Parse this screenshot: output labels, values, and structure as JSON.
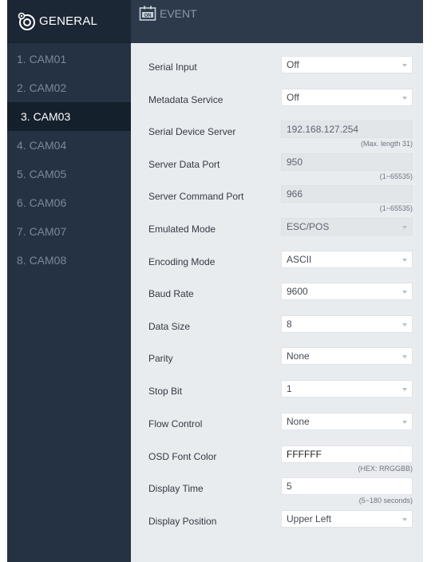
{
  "sidebar": {
    "header_label": "GENERAL",
    "header_icon": "gear-icon",
    "items": [
      {
        "label": "1. CAM01",
        "active": false
      },
      {
        "label": "2. CAM02",
        "active": false
      },
      {
        "label": "3. CAM03",
        "active": true
      },
      {
        "label": "4. CAM04",
        "active": false
      },
      {
        "label": "5. CAM05",
        "active": false
      },
      {
        "label": "6. CAM06",
        "active": false
      },
      {
        "label": "7. CAM07",
        "active": false
      },
      {
        "label": "8. CAM08",
        "active": false
      }
    ]
  },
  "header": {
    "title": "EVENT",
    "icon": "event-icon"
  },
  "settings": {
    "serial_input": {
      "label": "Serial Input",
      "value": "Off"
    },
    "metadata_service": {
      "label": "Metadata Service",
      "value": "Off"
    },
    "serial_device_server": {
      "label": "Serial Device Server",
      "value": "192.168.127.254",
      "hint": "(Max. length 31)"
    },
    "server_data_port": {
      "label": "Server Data Port",
      "value": "950",
      "hint": "(1~65535)"
    },
    "server_command_port": {
      "label": "Server Command Port",
      "value": "966",
      "hint": "(1~65535)"
    },
    "emulated_mode": {
      "label": "Emulated Mode",
      "value": "ESC/POS"
    },
    "encoding_mode": {
      "label": "Encoding Mode",
      "value": "ASCII"
    },
    "baud_rate": {
      "label": "Baud Rate",
      "value": "9600"
    },
    "data_size": {
      "label": "Data Size",
      "value": "8"
    },
    "parity": {
      "label": "Parity",
      "value": "None"
    },
    "stop_bit": {
      "label": "Stop Bit",
      "value": "1"
    },
    "flow_control": {
      "label": "Flow Control",
      "value": "None"
    },
    "osd_font_color": {
      "label": "OSD Font Color",
      "value": "FFFFFF",
      "hint": "(HEX: RRGGBB)"
    },
    "display_time": {
      "label": "Display Time",
      "value": "5",
      "hint": "(5~180 seconds)"
    },
    "display_position": {
      "label": "Display Position",
      "value": "Upper Left"
    }
  },
  "colors": {
    "sidebar_bg": "#243244",
    "sidebar_header_bg": "#1c2735",
    "active_item_bg": "#15202d",
    "content_bg": "#e9ecef"
  }
}
